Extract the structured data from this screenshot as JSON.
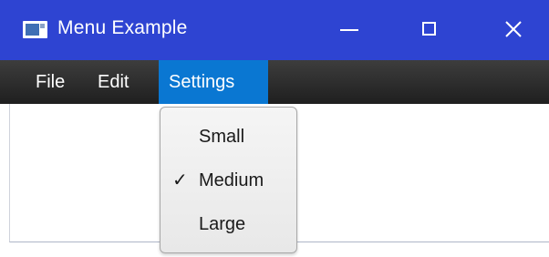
{
  "window": {
    "title": "Menu Example",
    "controls": {
      "minimize_icon": "minimize-icon",
      "maximize_icon": "maximize-icon",
      "close_icon": "close-icon"
    },
    "title_bar_color": "#2e44d2"
  },
  "menubar": {
    "items": [
      {
        "label": "File"
      },
      {
        "label": "Edit"
      },
      {
        "label": "Settings",
        "active": true
      }
    ],
    "active_color": "#0a77d2"
  },
  "dropdown": {
    "items": [
      {
        "label": "Small",
        "checked": false
      },
      {
        "label": "Medium",
        "checked": true,
        "check_glyph": "✓"
      },
      {
        "label": "Large",
        "checked": false
      }
    ]
  }
}
